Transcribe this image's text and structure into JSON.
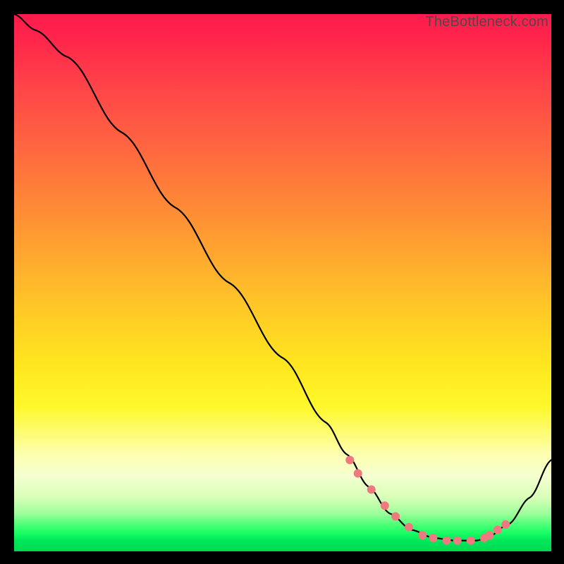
{
  "watermark": "TheBottleneck.com",
  "chart_data": {
    "type": "line",
    "title": "",
    "xlabel": "",
    "ylabel": "",
    "xlim": [
      0,
      100
    ],
    "ylim": [
      0,
      100
    ],
    "series": [
      {
        "name": "curve",
        "x": [
          0,
          4,
          10,
          20,
          30,
          40,
          50,
          58,
          62,
          66,
          70,
          74,
          78,
          82,
          86,
          88,
          92,
          96,
          100
        ],
        "values": [
          100,
          97,
          92,
          78,
          64,
          50,
          36,
          24,
          18,
          12,
          7,
          4,
          2.5,
          2,
          2,
          2.5,
          5,
          10,
          17
        ]
      }
    ],
    "markers": {
      "name": "line-dots",
      "x": [
        62.5,
        64.0,
        66.5,
        69.0,
        71.0,
        73.5,
        76.0,
        78.0,
        80.5,
        82.5,
        85.0,
        87.5,
        88.5,
        90.0,
        91.5
      ],
      "values": [
        17.0,
        14.5,
        11.5,
        8.5,
        6.5,
        4.5,
        3.0,
        2.5,
        2.0,
        2.0,
        2.0,
        2.5,
        3.0,
        4.0,
        5.0
      ],
      "color": "#ee7a80",
      "radius": 6
    },
    "curve_color": "#000000",
    "curve_width": 2.2
  }
}
